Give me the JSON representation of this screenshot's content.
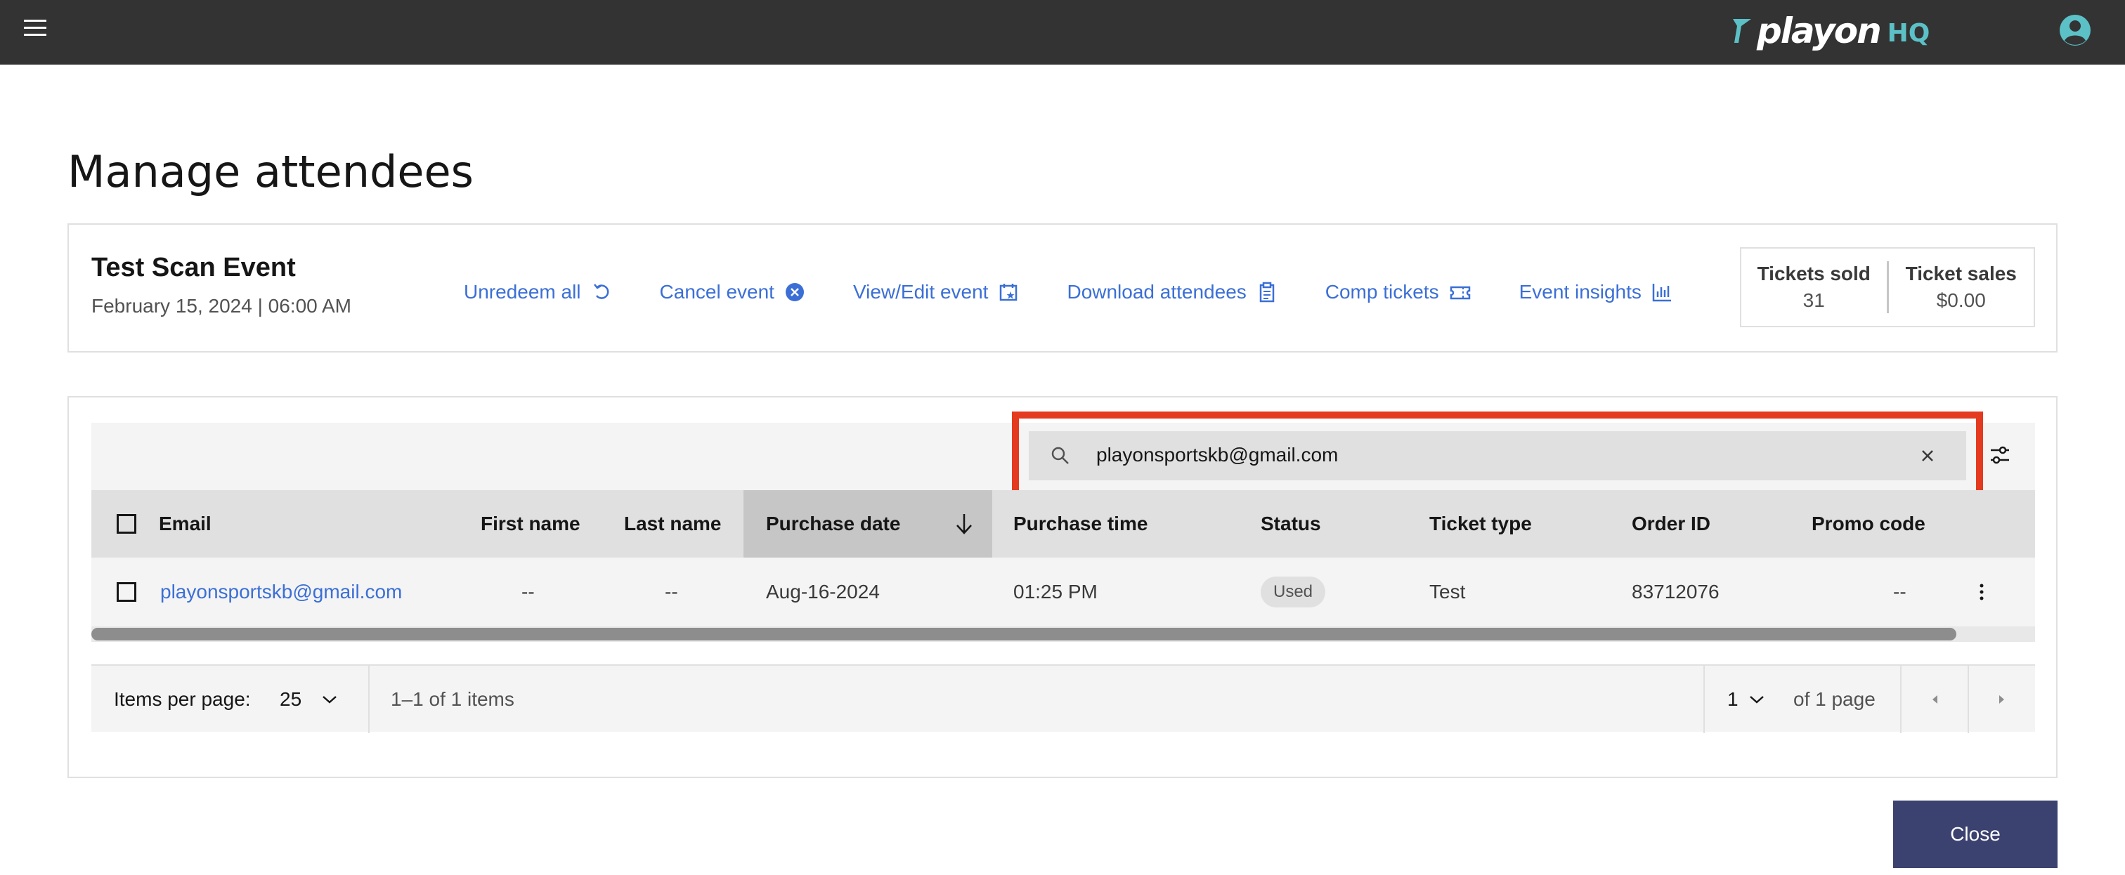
{
  "header": {
    "menu_icon": "hamburger-menu-icon",
    "brand": "playon",
    "brand_suffix": "HQ",
    "brand_color": "#5bc1c7",
    "bar_color": "#333333",
    "user_icon": "user-avatar-icon",
    "user_icon_color": "#5bc1c7"
  },
  "page": {
    "title": "Manage attendees"
  },
  "event": {
    "name": "Test Scan Event",
    "date": "February 15, 2024 | 06:00 AM",
    "actions": [
      {
        "label": "Unredeem all",
        "icon": "undo-icon"
      },
      {
        "label": "Cancel event",
        "icon": "cancel-circle-icon"
      },
      {
        "label": "View/Edit event",
        "icon": "calendar-star-icon"
      },
      {
        "label": "Download attendees",
        "icon": "clipboard-icon"
      },
      {
        "label": "Comp tickets",
        "icon": "ticket-icon"
      },
      {
        "label": "Event insights",
        "icon": "bar-chart-icon"
      }
    ],
    "link_color": "#3b6fd6",
    "stats": {
      "tickets_sold_label": "Tickets sold",
      "tickets_sold_value": "31",
      "ticket_sales_label": "Ticket sales",
      "ticket_sales_value": "$0.00"
    }
  },
  "search": {
    "value": "playonsportskb@gmail.com",
    "highlight_color": "#e43a1f"
  },
  "table": {
    "columns": [
      "Email",
      "First name",
      "Last name",
      "Purchase date",
      "Purchase time",
      "Status",
      "Ticket type",
      "Order ID",
      "Promo code"
    ],
    "sorted_column": "Purchase date",
    "sort_direction": "descending",
    "rows": [
      {
        "email": "playonsportskb@gmail.com",
        "first_name": "--",
        "last_name": "--",
        "purchase_date": "Aug-16-2024",
        "purchase_time": "01:25 PM",
        "status": "Used",
        "ticket_type": "Test",
        "order_id": "83712076",
        "promo_code": "--"
      }
    ]
  },
  "pagination": {
    "items_per_page_label": "Items per page:",
    "items_per_page": "25",
    "range": "1–1 of 1 items",
    "current_page": "1",
    "page_total": "of 1 page"
  },
  "footer": {
    "close_label": "Close",
    "close_color": "#3b4270"
  }
}
